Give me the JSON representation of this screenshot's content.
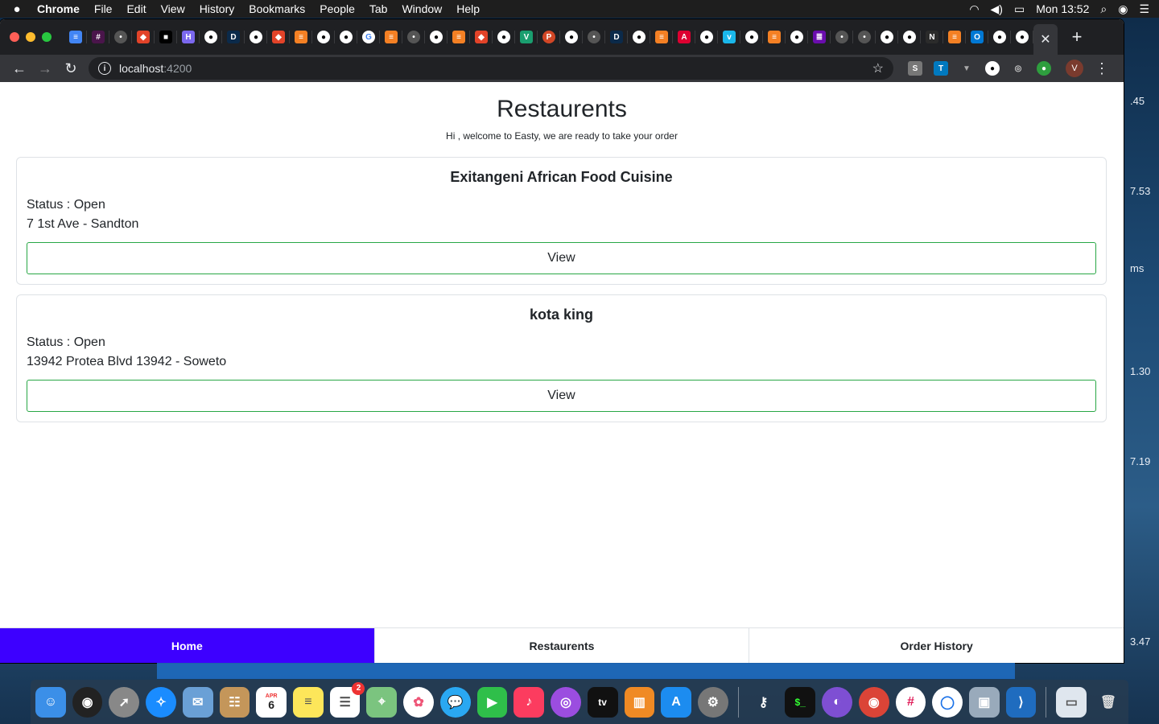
{
  "menubar": {
    "app": "Chrome",
    "items": [
      "File",
      "Edit",
      "View",
      "History",
      "Bookmarks",
      "People",
      "Tab",
      "Window",
      "Help"
    ],
    "clock": "Mon 13:52"
  },
  "browser": {
    "url_host": "localhost",
    "url_port": ":4200",
    "profile_initial": "V"
  },
  "page": {
    "title": "Restaurents",
    "subtitle": "Hi , welcome to Easty, we are ready to take your order"
  },
  "restaurants": [
    {
      "name": "Exitangeni African Food Cuisine",
      "status": "Status : Open",
      "address": "7 1st Ave - Sandton",
      "button": "View"
    },
    {
      "name": "kota king",
      "status": "Status : Open",
      "address": "13942 Protea Blvd 13942 - Soweto",
      "button": "View"
    }
  ],
  "bottom_nav": {
    "home": "Home",
    "restaurants": "Restaurents",
    "order_history": "Order History",
    "active": "home",
    "active_color": "#3d00ff"
  },
  "desktop_numbers": [
    ".45",
    "7.53",
    "ms",
    "1.30",
    "7.19",
    "3.47"
  ],
  "dock": {
    "calendar_month": "APR",
    "calendar_day": "6",
    "reminders_badge": "2",
    "appletv_label": "tv"
  }
}
